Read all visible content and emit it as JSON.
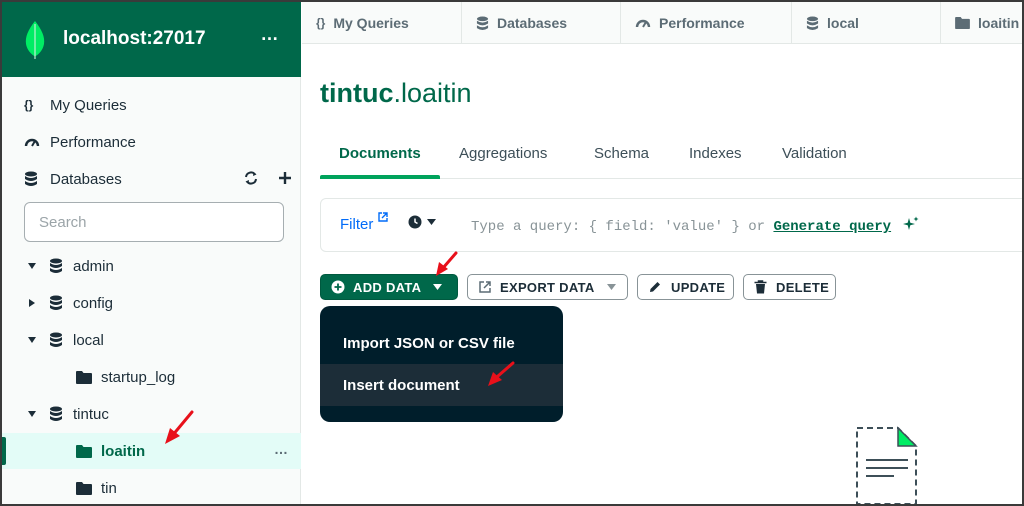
{
  "app": {
    "connection": "localhost:27017",
    "more_label": "…"
  },
  "colors": {
    "brand_green": "#00684a",
    "active_bg": "#e3fcf7",
    "link_blue": "#016bf8",
    "dropdown_bg": "#001e2b",
    "annotation_red": "#e8101a"
  },
  "sidebar": {
    "nav": [
      {
        "label": "My Queries",
        "icon": "braces-icon"
      },
      {
        "label": "Performance",
        "icon": "gauge-icon"
      },
      {
        "label": "Databases",
        "icon": "database-icon"
      }
    ],
    "search_placeholder": "Search",
    "tree": [
      {
        "label": "admin",
        "type": "database",
        "expanded": true
      },
      {
        "label": "config",
        "type": "database",
        "expanded": false
      },
      {
        "label": "local",
        "type": "database",
        "expanded": true
      },
      {
        "label": "startup_log",
        "type": "collection"
      },
      {
        "label": "tintuc",
        "type": "database",
        "expanded": true
      },
      {
        "label": "loaitin",
        "type": "collection",
        "active": true
      },
      {
        "label": "tin",
        "type": "collection"
      }
    ]
  },
  "workspace_tabs": [
    {
      "label": "My Queries",
      "icon": "braces-icon"
    },
    {
      "label": "Databases",
      "icon": "database-icon"
    },
    {
      "label": "Performance",
      "icon": "gauge-icon"
    },
    {
      "label": "local",
      "icon": "database-icon"
    },
    {
      "label": "loaitin",
      "icon": "folder-icon"
    }
  ],
  "namespace": {
    "database": "tintuc",
    "separator": ".",
    "collection": "loaitin"
  },
  "sub_tabs": [
    "Documents",
    "Aggregations",
    "Schema",
    "Indexes",
    "Validation"
  ],
  "active_sub_tab": "Documents",
  "query_bar": {
    "filter_label": "Filter",
    "placeholder_prefix": "Type a query: { field: 'value' } or ",
    "generate_label": "Generate query"
  },
  "toolbar": {
    "add_data": "ADD DATA",
    "export_data": "EXPORT DATA",
    "update": "UPDATE",
    "delete": "DELETE"
  },
  "add_data_menu": {
    "items": [
      "Import JSON or CSV file",
      "Insert document"
    ],
    "hovered_index": 1
  }
}
